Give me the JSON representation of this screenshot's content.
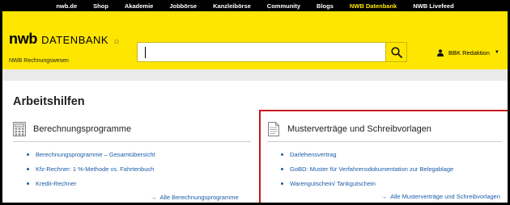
{
  "topnav": {
    "items": [
      {
        "label": "nwb.de"
      },
      {
        "label": "Shop"
      },
      {
        "label": "Akademie"
      },
      {
        "label": "Jobbörse"
      },
      {
        "label": "Kanzleibörse"
      },
      {
        "label": "Community"
      },
      {
        "label": "Blogs"
      },
      {
        "label": "NWB Datenbank",
        "active": true
      },
      {
        "label": "NWB Livefeed"
      }
    ]
  },
  "header": {
    "logo_nwb": "nwb",
    "logo_db": "DATENBANK",
    "subtitle": "NWB Rechnungswesen",
    "search": {
      "value": "",
      "placeholder": ""
    },
    "user_name": "BBK Redaktion"
  },
  "page_title": "Arbeitshilfen",
  "col1": {
    "title": "Berechnungsprogramme",
    "icon": "calculator-icon",
    "links": [
      "Berechnungsprogramme – Gesamtübersicht",
      "Kfz-Rechner: 1 %-Methode vs. Fahrtenbuch",
      "Kredit-Rechner"
    ],
    "all_link": "Alle Berechnungsprogramme"
  },
  "col2": {
    "title": "Musterverträge und Schreibvorlagen",
    "icon": "document-icon",
    "links": [
      "Darlehensvertrag",
      "GoBD: Muster für Verfahrensdokumentation zur Belegablage",
      "Warengutschein/ Tankgutschein"
    ],
    "all_link": "Alle Musterverträge und Schreibvorlagen"
  },
  "colors": {
    "brand_yellow": "#ffe600",
    "link_blue": "#1a5ca8",
    "highlight_red": "#c8161d"
  }
}
